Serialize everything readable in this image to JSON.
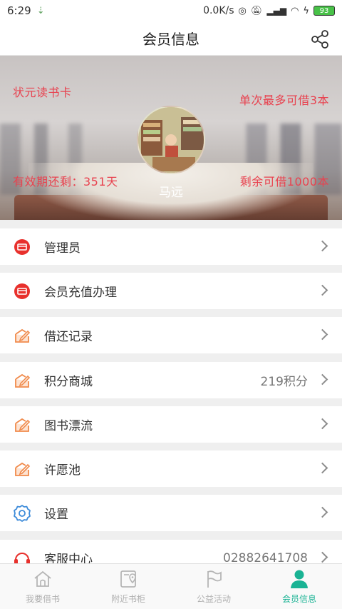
{
  "status_bar": {
    "time": "6:29",
    "network_speed": "0.0K/s",
    "battery": "93"
  },
  "header": {
    "title": "会员信息",
    "share_icon": "share-icon"
  },
  "banner": {
    "card_name": "状元读书卡",
    "borrow_limit": "单次最多可借3本",
    "validity": "有效期还剩：351天",
    "remaining": "剩余可借1000本",
    "user_name": "马远"
  },
  "menu": {
    "items": [
      {
        "label": "管理员",
        "icon": "card-icon",
        "value": ""
      },
      {
        "label": "会员充值办理",
        "icon": "card-icon",
        "value": ""
      },
      {
        "label": "借还记录",
        "icon": "edit-box-icon",
        "value": ""
      },
      {
        "label": "积分商城",
        "icon": "edit-box-icon",
        "value": "219积分"
      },
      {
        "label": "图书漂流",
        "icon": "edit-box-icon",
        "value": ""
      },
      {
        "label": "许愿池",
        "icon": "edit-box-icon",
        "value": ""
      },
      {
        "label": "设置",
        "icon": "gear-icon",
        "value": ""
      },
      {
        "label": "客服中心",
        "icon": "headset-icon",
        "value": "02882641708"
      }
    ]
  },
  "tabbar": {
    "tabs": [
      {
        "label": "我要借书",
        "icon": "home-icon",
        "active": false
      },
      {
        "label": "附近书柜",
        "icon": "location-book-icon",
        "active": false
      },
      {
        "label": "公益活动",
        "icon": "flag-icon",
        "active": false
      },
      {
        "label": "会员信息",
        "icon": "user-icon",
        "active": true
      }
    ]
  },
  "colors": {
    "accent": "#1ab394",
    "banner_text": "#e8424f",
    "icon_red": "#e8302c",
    "icon_orange": "#f08a4b",
    "icon_blue": "#3d8bd9"
  }
}
